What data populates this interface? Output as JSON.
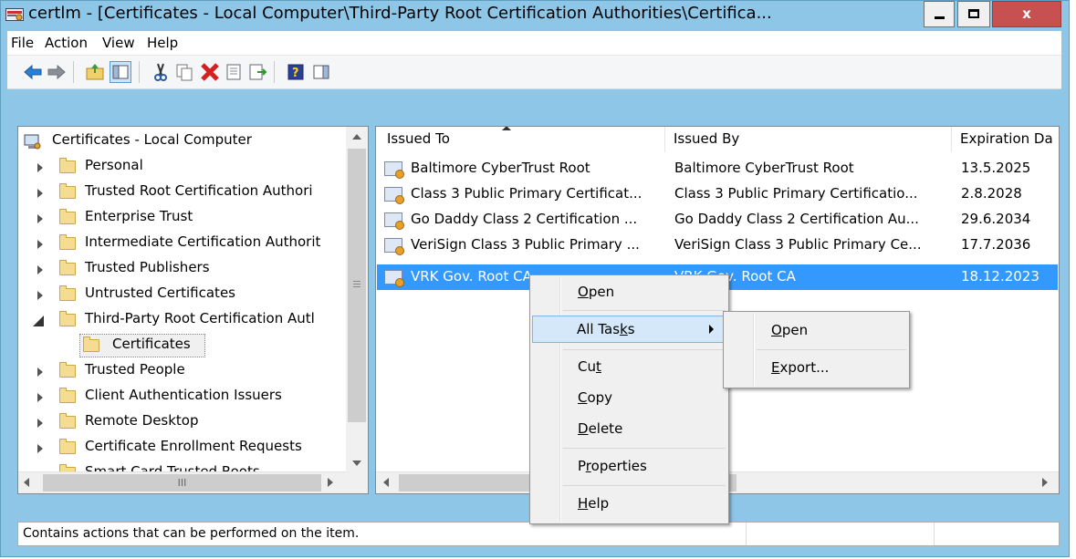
{
  "window": {
    "title": "certlm - [Certificates - Local Computer\\Third-Party Root Certification Authorities\\Certifica...",
    "close_label": "x"
  },
  "menu": [
    "File",
    "Action",
    "View",
    "Help"
  ],
  "toolbar": {
    "icons": [
      "back-icon",
      "forward-icon",
      "up-folder-icon",
      "show-hide-tree-icon",
      "cut-icon",
      "copy-icon",
      "delete-icon",
      "properties-icon",
      "export-list-icon",
      "help-icon",
      "action-pane-icon"
    ]
  },
  "tree": {
    "root": "Certificates - Local Computer",
    "items": [
      "Personal",
      "Trusted Root Certification Authori",
      "Enterprise Trust",
      "Intermediate Certification Authorit",
      "Trusted Publishers",
      "Untrusted Certificates",
      "Third-Party Root Certification Autl",
      "Certificates",
      "Trusted People",
      "Client Authentication Issuers",
      "Remote Desktop",
      "Certificate Enrollment Requests",
      "Smart Card Trusted Roots"
    ],
    "hscroll_thumb": "III"
  },
  "list": {
    "columns": [
      "Issued To",
      "Issued By",
      "Expiration Da"
    ],
    "rows": [
      {
        "issued_to": "Baltimore CyberTrust Root",
        "issued_by": "Baltimore CyberTrust Root",
        "expires": "13.5.2025"
      },
      {
        "issued_to": "Class 3 Public Primary Certificat...",
        "issued_by": "Class 3 Public Primary Certificatio...",
        "expires": "2.8.2028"
      },
      {
        "issued_to": "Go Daddy Class 2 Certification ...",
        "issued_by": "Go Daddy Class 2 Certification Au...",
        "expires": "29.6.2034"
      },
      {
        "issued_to": "VeriSign Class 3 Public Primary ...",
        "issued_by": "VeriSign Class 3 Public Primary Ce...",
        "expires": "17.7.2036"
      },
      {
        "issued_to": "VRK Gov. Root CA",
        "issued_by": "VRK Gov. Root CA",
        "expires": "18.12.2023"
      }
    ]
  },
  "context_menu": {
    "items": [
      {
        "pre": "",
        "u": "O",
        "post": "pen"
      },
      {
        "pre": "All Tas",
        "u": "k",
        "post": "s"
      },
      {
        "pre": "Cu",
        "u": "t",
        "post": ""
      },
      {
        "pre": "",
        "u": "C",
        "post": "opy"
      },
      {
        "pre": "",
        "u": "D",
        "post": "elete"
      },
      {
        "pre": "P",
        "u": "r",
        "post": "operties"
      },
      {
        "pre": "",
        "u": "H",
        "post": "elp"
      }
    ]
  },
  "submenu": {
    "items": [
      {
        "pre": "",
        "u": "O",
        "post": "pen"
      },
      {
        "pre": "",
        "u": "E",
        "post": "xport..."
      }
    ]
  },
  "status": "Contains actions that can be performed on the item."
}
